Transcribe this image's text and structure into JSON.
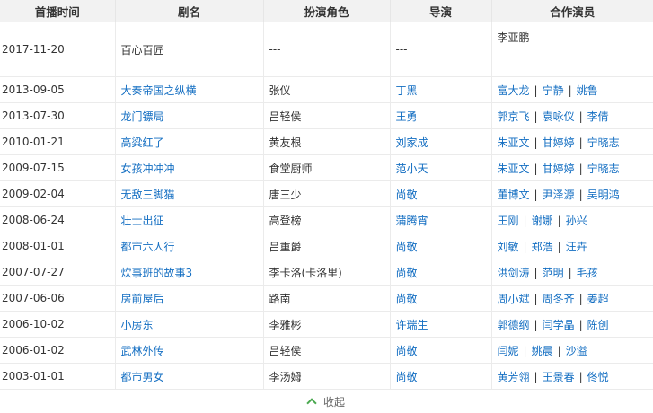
{
  "headers": [
    "首播时间",
    "剧名",
    "扮演角色",
    "导演",
    "合作演员"
  ],
  "rows": [
    {
      "date": "2017-11-20",
      "title": "百心百匠",
      "role": "---",
      "director": "---",
      "cast": [
        "李亚鹏"
      ]
    },
    {
      "date": "2013-09-05",
      "title": "大秦帝国之纵横",
      "role": "张仪",
      "director": "丁黑",
      "cast": [
        "富大龙",
        "宁静",
        "姚鲁"
      ]
    },
    {
      "date": "2013-07-30",
      "title": "龙门镖局",
      "role": "吕轻侯",
      "director": "王勇",
      "cast": [
        "郭京飞",
        "袁咏仪",
        "李倩"
      ]
    },
    {
      "date": "2010-01-21",
      "title": "高粱红了",
      "role": "黄友根",
      "director": "刘家成",
      "cast": [
        "朱亚文",
        "甘婷婷",
        "宁晓志"
      ]
    },
    {
      "date": "2009-07-15",
      "title": "女孩冲冲冲",
      "role": "食堂厨师",
      "director": "范小天",
      "cast": [
        "朱亚文",
        "甘婷婷",
        "宁晓志"
      ]
    },
    {
      "date": "2009-02-04",
      "title": "无敌三脚猫",
      "role": "唐三少",
      "director": "尚敬",
      "cast": [
        "董博文",
        "尹泽源",
        "吴明鸿"
      ]
    },
    {
      "date": "2008-06-24",
      "title": "壮士出征",
      "role": "高登榜",
      "director": "蒲腾宵",
      "cast": [
        "王刚",
        "谢娜",
        "孙兴"
      ]
    },
    {
      "date": "2008-01-01",
      "title": "都市六人行",
      "role": "吕重爵",
      "director": "尚敬",
      "cast": [
        "刘敏",
        "郑浩",
        "汪卉"
      ]
    },
    {
      "date": "2007-07-27",
      "title": "炊事班的故事3",
      "role": "李卡洛(卡洛里)",
      "director": "尚敬",
      "cast": [
        "洪剑涛",
        "范明",
        "毛孩"
      ]
    },
    {
      "date": "2007-06-06",
      "title": "房前屋后",
      "role": "路南",
      "director": "尚敬",
      "cast": [
        "周小斌",
        "周冬齐",
        "姜超"
      ]
    },
    {
      "date": "2006-10-02",
      "title": "小房东",
      "role": "李雅彬",
      "director": "许瑞生",
      "cast": [
        "郭德纲",
        "闫学晶",
        "陈创"
      ]
    },
    {
      "date": "2006-01-02",
      "title": "武林外传",
      "role": "吕轻侯",
      "director": "尚敬",
      "cast": [
        "闫妮",
        "姚晨",
        "沙溢"
      ]
    },
    {
      "date": "2003-01-01",
      "title": "都市男女",
      "role": "李汤姆",
      "director": "尚敬",
      "cast": [
        "黄芳翎",
        "王景春",
        "佟悦"
      ]
    }
  ],
  "collapse_label": "收起",
  "colors": {
    "link": "#136ec2",
    "header_bg": "#f2f2f2",
    "border": "#ebebeb",
    "chevron": "#4aa84f"
  }
}
